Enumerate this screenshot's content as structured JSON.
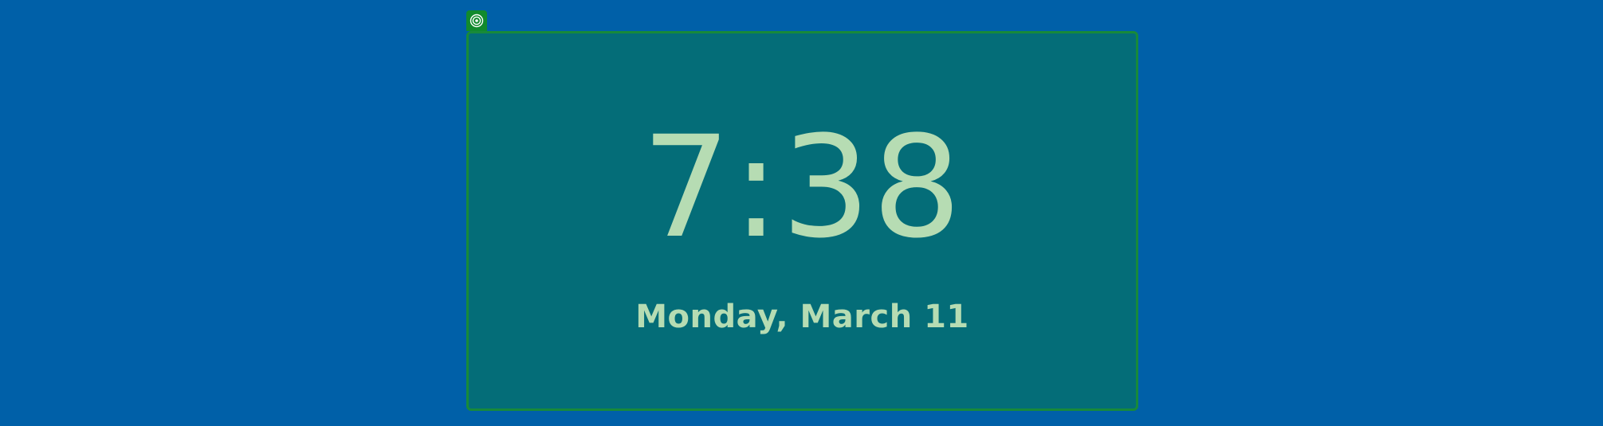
{
  "desktop": {
    "background_color": "#0060a8"
  },
  "widget": {
    "handle_icon": "target-icon",
    "handle_color": "#118a2d",
    "panel_color": "#046d78",
    "border_color": "#188a3a",
    "text_color": "#b6dcb3",
    "time": "7:38",
    "date": "Monday, March 11"
  }
}
